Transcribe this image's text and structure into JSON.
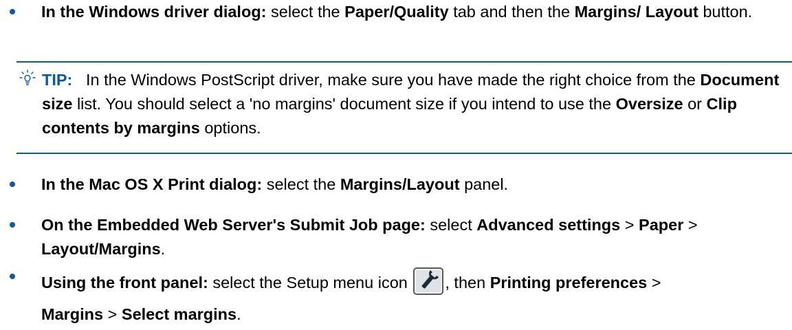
{
  "bullets": [
    {
      "label": "In the Windows driver dialog:",
      "t1": "select the",
      "b1": "Paper/Quality",
      "t2": "tab and then the",
      "b2": "Margins/ Layout",
      "t3": "button."
    },
    {
      "label": "In the Mac OS X Print dialog:",
      "t1": "select the",
      "b1": "Margins/Layout",
      "t2": "panel."
    },
    {
      "label": "On the Embedded Web Server's Submit Job page:",
      "t1": "select",
      "b1": "Advanced settings",
      "sep1": ">",
      "b2": "Paper",
      "sep2": ">",
      "b3": "Layout/Margins",
      "t2": "."
    },
    {
      "label": "Using the front panel:",
      "t1": "select the Setup menu icon",
      "t2": ", then",
      "b1": "Printing preferences",
      "sep1": ">",
      "b2": "Margins",
      "sep2": ">",
      "b3": "Select margins",
      "t3": "."
    }
  ],
  "tip": {
    "label": "TIP:",
    "t1": "In the Windows PostScript driver, make sure you have made the right choice from the",
    "b1": "Document size",
    "t2": "list. You should select a 'no margins' document size if you intend to use the",
    "b2": "Oversize",
    "t3": "or",
    "b3": "Clip contents by margins",
    "t4": "options."
  },
  "icons": {
    "tip": "lightbulb-icon",
    "setup": "setup-wrench-icon"
  },
  "colors": {
    "accent": "#0a5aa5"
  }
}
